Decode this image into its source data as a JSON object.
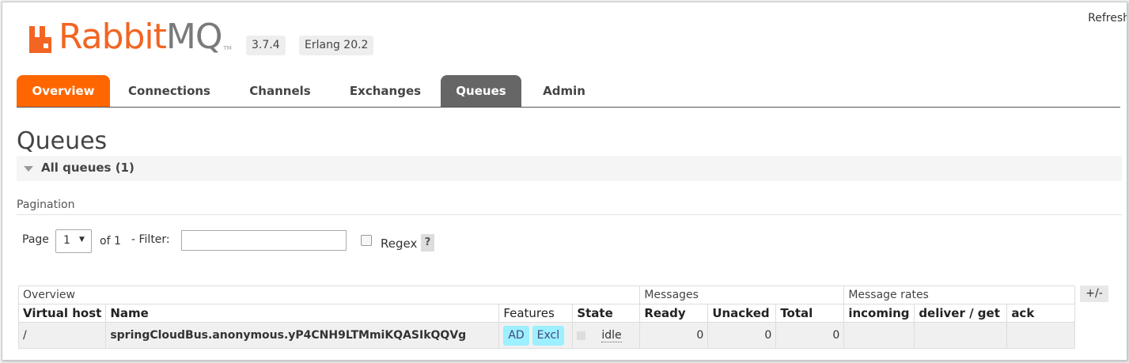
{
  "header": {
    "refresh_label": "Refresh",
    "logo": {
      "rabbit": "Rabbit",
      "mq": "MQ",
      "tm": "TM"
    },
    "version": "3.7.4",
    "erlang": "Erlang 20.2"
  },
  "colors": {
    "brand_orange": "#ff6600",
    "active_tab_grey": "#666666",
    "feature_pill": "#99eeff"
  },
  "nav": {
    "overview": "Overview",
    "connections": "Connections",
    "channels": "Channels",
    "exchanges": "Exchanges",
    "queues": "Queues",
    "admin": "Admin"
  },
  "page": {
    "title": "Queues",
    "section": "All queues (1)"
  },
  "pagination": {
    "heading": "Pagination",
    "page_label": "Page",
    "page_value": "1",
    "of_label": "of 1",
    "filter_label": "- Filter:",
    "filter_value": "",
    "regex_label": "Regex",
    "help_label": "?"
  },
  "table": {
    "toggle_label": "+/-",
    "groups": {
      "overview": "Overview",
      "messages": "Messages",
      "message_rates": "Message rates"
    },
    "columns": {
      "vhost": "Virtual host",
      "name": "Name",
      "features": "Features",
      "state": "State",
      "ready": "Ready",
      "unacked": "Unacked",
      "total": "Total",
      "incoming": "incoming",
      "deliver_get": "deliver / get",
      "ack": "ack"
    },
    "rows": [
      {
        "vhost": "/",
        "name": "springCloudBus.anonymous.yP4CNH9LTMmiKQASIkQQVg",
        "feature_ad": "AD",
        "feature_excl": "Excl",
        "state": "idle",
        "ready": "0",
        "unacked": "0",
        "total": "0",
        "incoming": "",
        "deliver_get": "",
        "ack": ""
      }
    ]
  }
}
